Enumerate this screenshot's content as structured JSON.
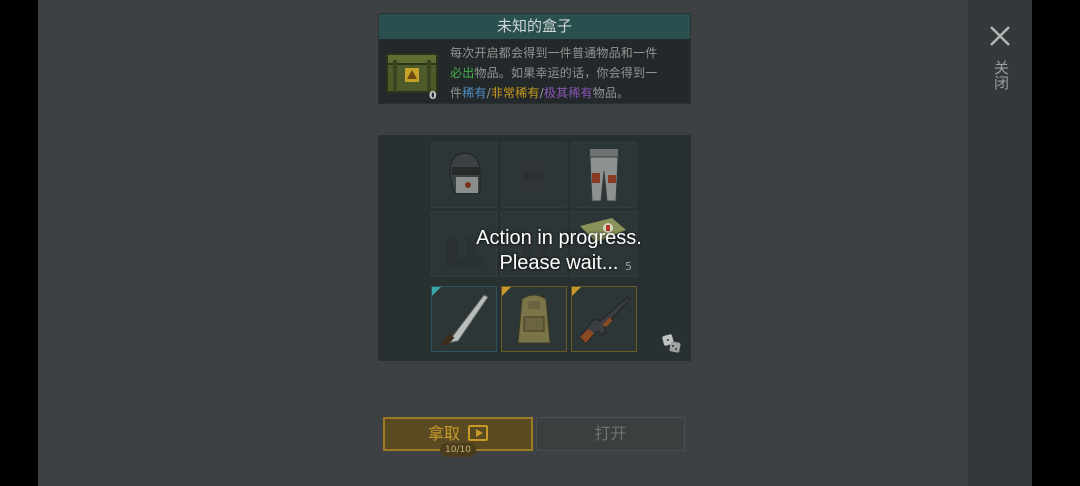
{
  "header": {
    "title": "未知的盒子",
    "crate_count": "0",
    "desc_line1": "每次开启都会得到一件普通物品和一件",
    "desc_green": "必出",
    "desc_line2": "物品。如果幸运的话，你会得到一",
    "desc_prefix3": "件",
    "desc_rare": "稀有",
    "desc_sep1": "/",
    "desc_very_rare": "非常稀有",
    "desc_sep2": "/",
    "desc_ultra_rare": "极其稀有",
    "desc_suffix": "物品。"
  },
  "items": {
    "slots": [
      {
        "icon": "helmet-icon"
      },
      {
        "icon": "vest-icon"
      },
      {
        "icon": "pants-icon"
      },
      {
        "icon": "boots-icon"
      },
      {
        "icon": "gloves-icon"
      },
      {
        "icon": "medkit-bag-icon",
        "count": "5"
      },
      {
        "icon": "machete-icon",
        "rarity": "rare"
      },
      {
        "icon": "backpack-icon",
        "rarity": "very-rare"
      },
      {
        "icon": "rifle-icon",
        "rarity": "very-rare"
      }
    ]
  },
  "overlay": {
    "line1": "Action in progress.",
    "line2": "Please wait..."
  },
  "buttons": {
    "take_label": "拿取",
    "take_badge": "10/10",
    "open_label": "打开"
  },
  "close": {
    "label": "关闭"
  },
  "colors": {
    "accent_gold": "#c79a2a",
    "rare_blue": "#3aa6a6",
    "title_bar": "#2a4f4f"
  }
}
